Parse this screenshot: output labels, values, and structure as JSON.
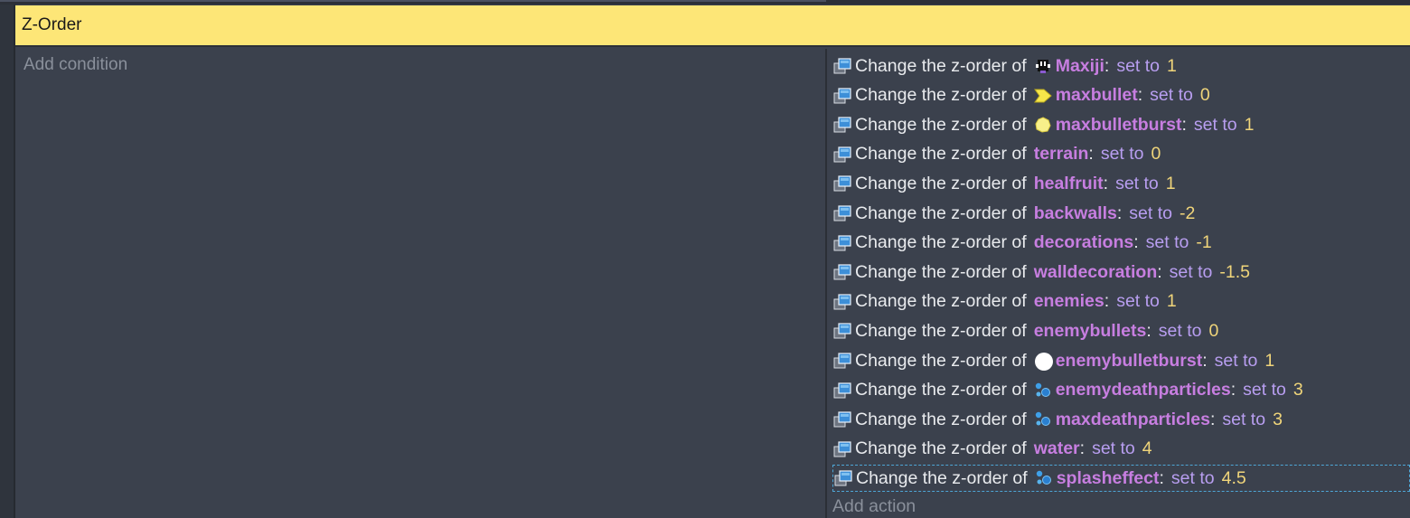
{
  "event": {
    "title": "Z-Order",
    "add_condition_label": "Add condition",
    "add_action_label": "Add action"
  },
  "action_text": {
    "lead": "Change the z-order of",
    "set_to": "set to",
    "colon": ":"
  },
  "actions": [
    {
      "object": "Maxiji",
      "icon": "maxiji-sprite-icon",
      "value": "1"
    },
    {
      "object": "maxbullet",
      "icon": "maxbullet-sprite-icon",
      "value": "0"
    },
    {
      "object": "maxbulletburst",
      "icon": "maxbulletburst-sprite-icon",
      "value": "1"
    },
    {
      "object": "terrain",
      "icon": null,
      "value": "0"
    },
    {
      "object": "healfruit",
      "icon": null,
      "value": "1"
    },
    {
      "object": "backwalls",
      "icon": null,
      "value": "-2"
    },
    {
      "object": "decorations",
      "icon": null,
      "value": "-1"
    },
    {
      "object": "walldecoration",
      "icon": null,
      "value": "-1.5"
    },
    {
      "object": "enemies",
      "icon": null,
      "value": "1"
    },
    {
      "object": "enemybullets",
      "icon": null,
      "value": "0"
    },
    {
      "object": "enemybulletburst",
      "icon": "white-circle-icon",
      "value": "1"
    },
    {
      "object": "enemydeathparticles",
      "icon": "particle-emitter-icon",
      "value": "3"
    },
    {
      "object": "maxdeathparticles",
      "icon": "particle-emitter-icon",
      "value": "3"
    },
    {
      "object": "water",
      "icon": null,
      "value": "4"
    },
    {
      "object": "splasheffect",
      "icon": "particle-emitter-icon",
      "value": "4.5",
      "selected": true
    }
  ],
  "colors": {
    "header_bg": "#fde677",
    "panel_bg": "#3b414d",
    "object_name": "#c77ee0",
    "set_to": "#b89ef0",
    "value": "#f0d57a",
    "selection": "#4ea6d6"
  }
}
